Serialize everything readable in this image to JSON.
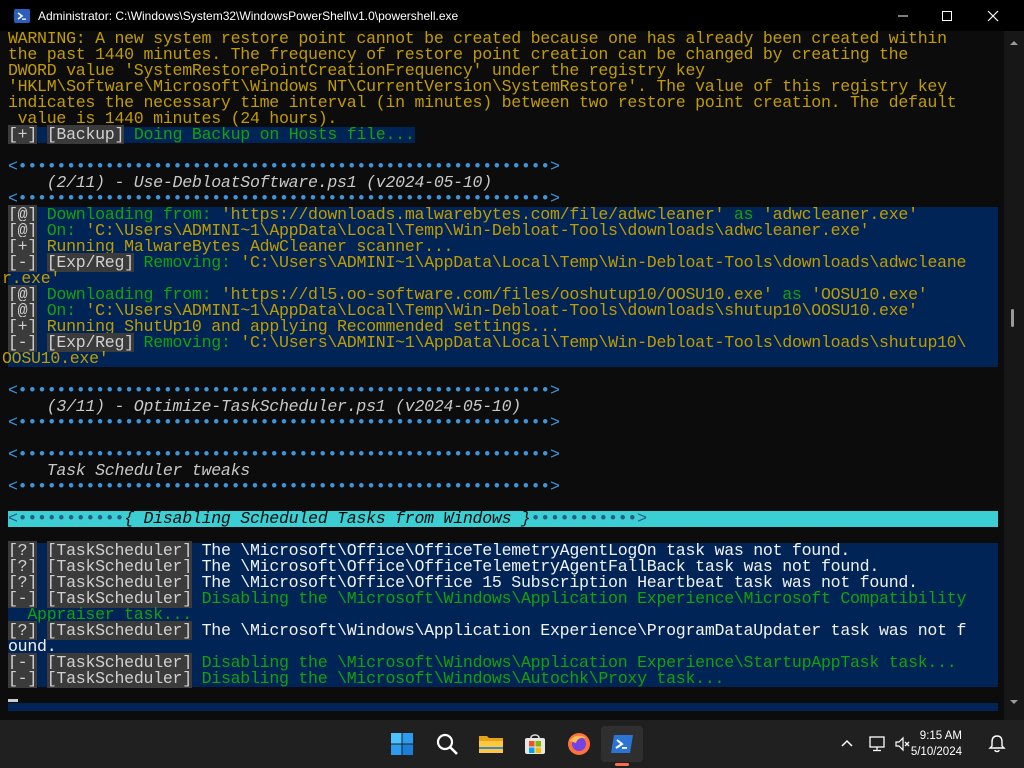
{
  "window": {
    "title": "Administrator: C:\\Windows\\System32\\WindowsPowerShell\\v1.0\\powershell.exe"
  },
  "console": {
    "l0": "WARNING: A new system restore point cannot be created because one has already been created within",
    "l1": "the past 1440 minutes. The frequency of restore point creation can be changed by creating the",
    "l2": "DWORD value 'SystemRestorePointCreationFrequency' under the registry key",
    "l3": "'HKLM\\Software\\Microsoft\\Windows NT\\CurrentVersion\\SystemRestore'. The value of this registry key",
    "l4": "indicates the necessary time interval (in minutes) between two restore point creation. The default",
    "l5": " value is 1440 minutes (24 hours).",
    "tag_plus": "[+]",
    "tag_at": "[@]",
    "tag_minus": "[-]",
    "tag_q": "[?]",
    "tag_backup": "[Backup]",
    "tag_expreg": "[Exp/Reg]",
    "tag_ts": "[TaskScheduler]",
    "backup_msg": " Doing Backup on Hosts file...",
    "sep_open": "<•••••••••••••••••••••••••••••••••••••••••••••••••••••••>",
    "hdr_2": "    (2/11) - Use-DebloatSoftware.ps1 (v2024-05-10)",
    "d1_a": " Downloading from: ",
    "d1_url": "'https://downloads.malwarebytes.com/file/adwcleaner'",
    "d1_as": " as ",
    "d1_file": "'adwcleaner.exe'",
    "on1_a": " On: ",
    "on1_path": "'C:\\Users\\ADMINI~1\\AppData\\Local\\Temp\\Win-Debloat-Tools\\downloads\\adwcleaner.exe'",
    "run1": " Running MalwareBytes AdwCleaner scanner...",
    "rem1_a": " Removing: ",
    "rem1_path": "'C:\\Users\\ADMINI~1\\AppData\\Local\\Temp\\Win-Debloat-Tools\\downloads\\adwcleane",
    "rem1_wrap": "r.exe'",
    "d2_a": " Downloading from: ",
    "d2_url": "'https://dl5.oo-software.com/files/ooshutup10/OOSU10.exe'",
    "d2_as": " as ",
    "d2_file": "'OOSU10.exe'",
    "on2_a": " On: ",
    "on2_path": "'C:\\Users\\ADMINI~1\\AppData\\Local\\Temp\\Win-Debloat-Tools\\downloads\\shutup10\\OOSU10.exe'",
    "run2": " Running ShutUp10 and applying Recommended settings...",
    "rem2_a": " Removing: ",
    "rem2_path": "'C:\\Users\\ADMINI~1\\AppData\\Local\\Temp\\Win-Debloat-Tools\\downloads\\shutup10\\",
    "rem2_wrap": "OOSU10.exe'",
    "hdr_3": "    (3/11) - Optimize-TaskScheduler.ps1 (v2024-05-10)",
    "hdr_ts": "    Task Scheduler tweaks",
    "sec_left": "<•••••••••••",
    "sec_title": "{ Disabling Scheduled Tasks from Windows }",
    "sec_right": "•••••••••••>",
    "ts1": " The \\Microsoft\\Office\\OfficeTelemetryAgentLogOn task was not found.",
    "ts2": " The \\Microsoft\\Office\\OfficeTelemetryAgentFallBack task was not found.",
    "ts3": " The \\Microsoft\\Office\\Office 15 Subscription Heartbeat task was not found.",
    "ts4": " Disabling the \\Microsoft\\Windows\\Application Experience\\Microsoft Compatibility",
    "ts4_wrap": "  Appraiser task...",
    "ts5": " The \\Microsoft\\Windows\\Application Experience\\ProgramDataUpdater task was not f",
    "ts5_wrap": "ound.",
    "ts6": " Disabling the \\Microsoft\\Windows\\Application Experience\\StartupAppTask task...",
    "ts7": " Disabling the \\Microsoft\\Windows\\Autochk\\Proxy task..."
  },
  "taskbar": {
    "time": "9:15 AM",
    "date": "5/10/2024",
    "icons": [
      "windows-start-icon",
      "search-icon",
      "file-explorer-icon",
      "microsoft-store-icon",
      "firefox-icon",
      "powershell-icon"
    ],
    "tray_icons": [
      "chevron-up-icon",
      "network-icon",
      "volume-muted-icon",
      "notification-icon"
    ]
  },
  "colors": {
    "console_bg": "#0c0c0c",
    "highlight_bg": "#012456",
    "section_bg": "#3bcfd4",
    "green": "#13a10e",
    "yellow": "#c19c00",
    "cyan": "#3a96dd"
  }
}
